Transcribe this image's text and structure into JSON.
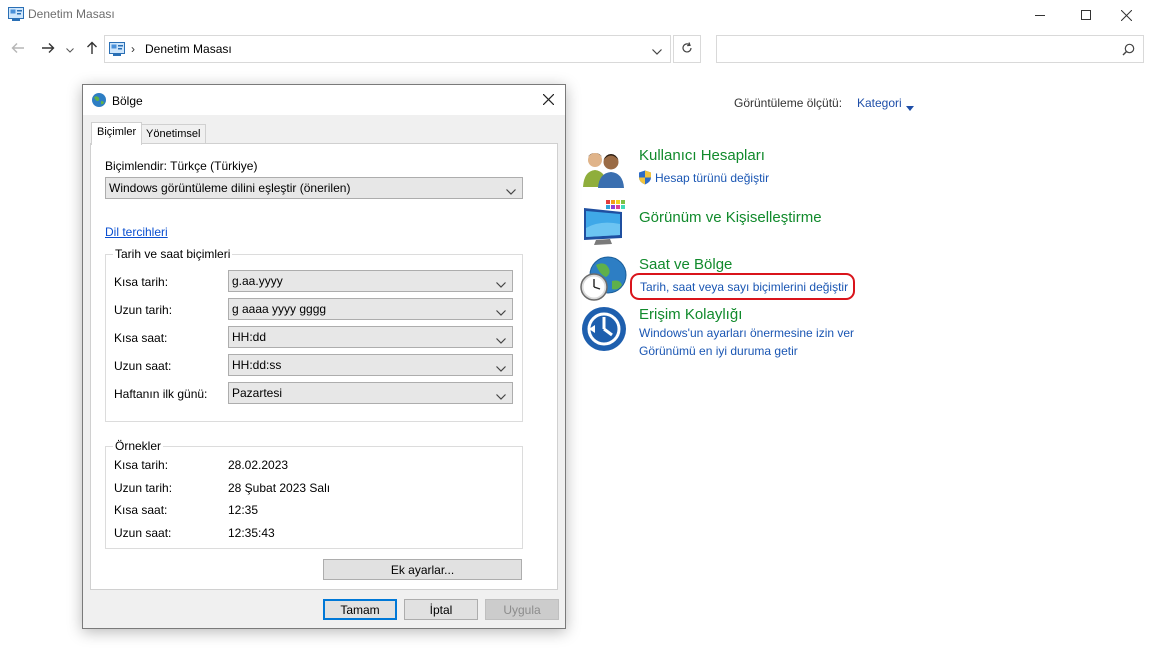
{
  "window": {
    "title": "Denetim Masası",
    "minimize_icon": "minimize-icon",
    "maximize_icon": "maximize-icon",
    "close_icon": "close-icon"
  },
  "address_bar": {
    "breadcrumb": [
      "Denetim Masası"
    ],
    "search_placeholder": ""
  },
  "view_by": {
    "label": "Görüntüleme ölçütü:",
    "value": "Kategori"
  },
  "categories": [
    {
      "title": "Kullanıcı Hesapları",
      "icon": "user-accounts-icon",
      "links": [
        {
          "text": "Hesap türünü değiştir",
          "shield": true
        }
      ]
    },
    {
      "title": "Görünüm ve Kişiselleştirme",
      "icon": "appearance-icon",
      "links": []
    },
    {
      "title": "Saat ve Bölge",
      "icon": "clock-region-icon",
      "links": [
        {
          "text": "Tarih, saat veya sayı biçimlerini değiştir",
          "highlighted": true
        }
      ]
    },
    {
      "title": "Erişim Kolaylığı",
      "icon": "ease-of-access-icon",
      "links": [
        {
          "text": "Windows'un ayarları önermesine izin ver"
        },
        {
          "text": "Görünümü en iyi duruma getir"
        }
      ]
    }
  ],
  "highlight_color": "#d9141b",
  "dialog": {
    "title": "Bölge",
    "tabs": [
      "Biçimler",
      "Yönetimsel"
    ],
    "active_tab": "Biçimler",
    "format_label": "Biçimlendir: Türkçe (Türkiye)",
    "format_value": "Windows görüntüleme dilini eşleştir (önerilen)",
    "language_prefs_link": "Dil tercihleri",
    "datetime_group": {
      "title": "Tarih ve saat biçimleri",
      "rows": [
        {
          "label": "Kısa tarih:",
          "value": "g.aa.yyyy"
        },
        {
          "label": "Uzun tarih:",
          "value": "g aaaa yyyy gggg"
        },
        {
          "label": "Kısa saat:",
          "value": "HH:dd"
        },
        {
          "label": "Uzun saat:",
          "value": "HH:dd:ss"
        },
        {
          "label": "Haftanın ilk günü:",
          "value": "Pazartesi"
        }
      ]
    },
    "examples_group": {
      "title": "Örnekler",
      "rows": [
        {
          "label": "Kısa tarih:",
          "value": "28.02.2023"
        },
        {
          "label": "Uzun tarih:",
          "value": "28 Şubat 2023 Salı"
        },
        {
          "label": "Kısa saat:",
          "value": "12:35"
        },
        {
          "label": "Uzun saat:",
          "value": "12:35:43"
        }
      ]
    },
    "additional_settings_button": "Ek ayarlar...",
    "ok_button": "Tamam",
    "cancel_button": "İptal",
    "apply_button": "Uygula"
  }
}
